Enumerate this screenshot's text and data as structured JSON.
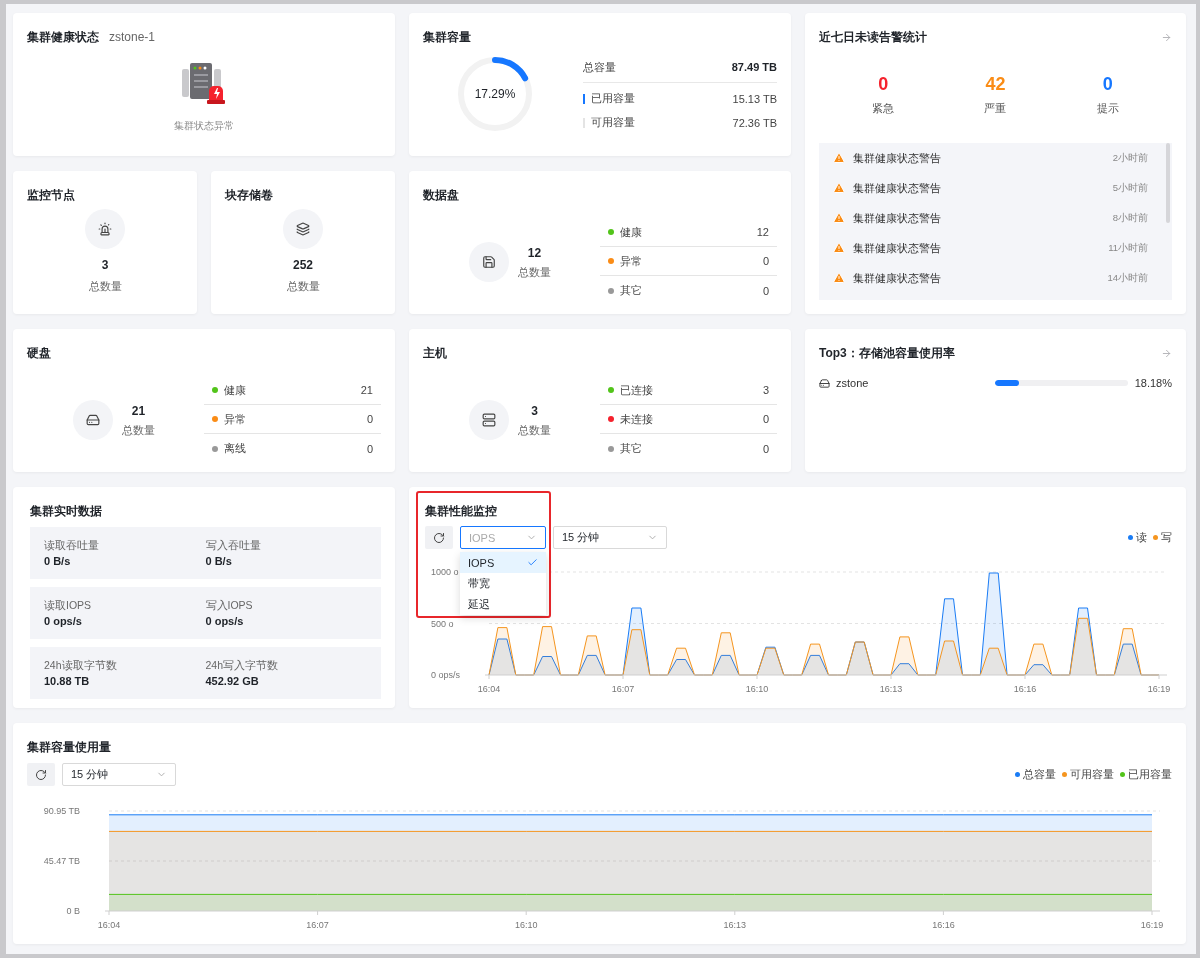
{
  "health": {
    "title": "集群健康状态",
    "cluster": "zstone-1",
    "status": "集群状态异常",
    "abnormal": true
  },
  "capacity": {
    "title": "集群容量",
    "percent": "17.29%",
    "rows": [
      {
        "kind": "total",
        "label": "总容量",
        "value": "87.49 TB"
      },
      {
        "kind": "used",
        "label": "已用容量",
        "value": "15.13 TB"
      },
      {
        "kind": "free",
        "label": "可用容量",
        "value": "72.36 TB"
      }
    ]
  },
  "alerts": {
    "title": "近七日未读告警统计",
    "counts": [
      {
        "value": "0",
        "label": "紧急",
        "color": "#f5222d"
      },
      {
        "value": "42",
        "label": "严重",
        "color": "#fa8c16"
      },
      {
        "value": "0",
        "label": "提示",
        "color": "#1677ff"
      }
    ],
    "items": [
      {
        "text": "集群健康状态警告",
        "time": "2小时前"
      },
      {
        "text": "集群健康状态警告",
        "time": "5小时前"
      },
      {
        "text": "集群健康状态警告",
        "time": "8小时前"
      },
      {
        "text": "集群健康状态警告",
        "time": "11小时前"
      },
      {
        "text": "集群健康状态警告",
        "time": "14小时前"
      }
    ]
  },
  "monitor_nodes": {
    "title": "监控节点",
    "count": "3",
    "label": "总数量"
  },
  "block_volumes": {
    "title": "块存储卷",
    "count": "252",
    "label": "总数量"
  },
  "data_disks": {
    "title": "数据盘",
    "count": "12",
    "label": "总数量",
    "statuses": [
      {
        "label": "健康",
        "value": "12",
        "color": "#52c41a"
      },
      {
        "label": "异常",
        "value": "0",
        "color": "#fa8c16"
      },
      {
        "label": "其它",
        "value": "0",
        "color": "#999999"
      }
    ]
  },
  "disks": {
    "title": "硬盘",
    "count": "21",
    "label": "总数量",
    "statuses": [
      {
        "label": "健康",
        "value": "21",
        "color": "#52c41a"
      },
      {
        "label": "异常",
        "value": "0",
        "color": "#fa8c16"
      },
      {
        "label": "离线",
        "value": "0",
        "color": "#999999"
      }
    ]
  },
  "hosts": {
    "title": "主机",
    "count": "3",
    "label": "总数量",
    "statuses": [
      {
        "label": "已连接",
        "value": "3",
        "color": "#52c41a"
      },
      {
        "label": "未连接",
        "value": "0",
        "color": "#f5222d"
      },
      {
        "label": "其它",
        "value": "0",
        "color": "#999999"
      }
    ]
  },
  "top3": {
    "title": "Top3：存储池容量使用率",
    "pools": [
      {
        "name": "zstone",
        "level": 0.1818,
        "percent": "18.18%"
      }
    ]
  },
  "realtime": {
    "title": "集群实时数据",
    "groups": [
      {
        "items": [
          {
            "label": "读取吞吐量",
            "value": "0 B/s"
          },
          {
            "label": "写入吞吐量",
            "value": "0 B/s"
          }
        ]
      },
      {
        "items": [
          {
            "label": "读取IOPS",
            "value": "0 ops/s"
          },
          {
            "label": "写入IOPS",
            "value": "0 ops/s"
          }
        ]
      },
      {
        "items": [
          {
            "label": "24h读取字节数",
            "value": "10.88 TB"
          },
          {
            "label": "24h写入字节数",
            "value": "452.92 GB"
          }
        ]
      }
    ]
  },
  "performance": {
    "title": "集群性能监控",
    "highlighted": true,
    "metric_select": {
      "value": "IOPS",
      "open": true,
      "options": [
        {
          "label": "IOPS",
          "selected": true
        },
        {
          "label": "带宽",
          "selected": false
        },
        {
          "label": "延迟",
          "selected": false
        }
      ]
    },
    "range_select": {
      "value": "15 分钟"
    },
    "chart_data": {
      "type": "area",
      "ylim": [
        0,
        1000
      ],
      "yticks": [
        {
          "value": 0,
          "label": "0 ops/s"
        },
        {
          "value": 500,
          "label": "500 o"
        },
        {
          "value": 1000,
          "label": "1000 o"
        }
      ],
      "categories": [
        "16:04",
        null,
        null,
        null,
        null,
        null,
        null,
        null,
        null,
        null,
        null,
        null,
        null,
        null,
        null,
        "16:07",
        null,
        null,
        null,
        null,
        null,
        null,
        null,
        null,
        null,
        null,
        null,
        null,
        null,
        null,
        "16:10",
        null,
        null,
        null,
        null,
        null,
        null,
        null,
        null,
        null,
        null,
        null,
        null,
        null,
        null,
        "16:13",
        null,
        null,
        null,
        null,
        null,
        null,
        null,
        null,
        null,
        null,
        null,
        null,
        null,
        null,
        "16:16",
        null,
        null,
        null,
        null,
        null,
        null,
        null,
        null,
        null,
        null,
        null,
        null,
        null,
        null,
        "16:19"
      ],
      "series": [
        {
          "name": "读",
          "color": "#1a7cf5",
          "values": [
            0,
            350,
            350,
            0,
            0,
            0,
            180,
            180,
            0,
            0,
            0,
            190,
            190,
            0,
            0,
            0,
            650,
            650,
            0,
            0,
            0,
            150,
            150,
            0,
            0,
            0,
            190,
            190,
            0,
            0,
            0,
            270,
            270,
            0,
            0,
            0,
            190,
            190,
            0,
            0,
            0,
            320,
            320,
            0,
            0,
            0,
            110,
            110,
            0,
            0,
            0,
            740,
            740,
            0,
            0,
            0,
            990,
            990,
            0,
            0,
            0,
            100,
            100,
            0,
            0,
            0,
            650,
            650,
            0,
            0,
            0,
            300,
            300,
            0,
            0,
            0
          ]
        },
        {
          "name": "写",
          "color": "#f5951f",
          "values": [
            0,
            460,
            460,
            0,
            0,
            0,
            470,
            470,
            0,
            0,
            0,
            380,
            380,
            0,
            0,
            0,
            440,
            440,
            0,
            0,
            0,
            260,
            260,
            0,
            0,
            0,
            410,
            410,
            0,
            0,
            0,
            260,
            260,
            0,
            0,
            0,
            300,
            300,
            0,
            0,
            0,
            320,
            320,
            0,
            0,
            0,
            370,
            370,
            0,
            0,
            0,
            330,
            330,
            0,
            0,
            0,
            260,
            260,
            0,
            0,
            0,
            300,
            300,
            0,
            0,
            0,
            550,
            550,
            0,
            0,
            0,
            450,
            450,
            0,
            0,
            0
          ]
        }
      ]
    }
  },
  "capacity_usage": {
    "title": "集群容量使用量",
    "range_select": {
      "value": "15 分钟"
    },
    "chart_data": {
      "type": "area",
      "ylim": [
        0,
        90.95
      ],
      "yticks": [
        {
          "value": 0,
          "label": "0 B"
        },
        {
          "value": 45.47,
          "label": "45.47 TB"
        },
        {
          "value": 90.95,
          "label": "90.95 TB"
        }
      ],
      "categories": [
        "16:04",
        "16:07",
        "16:10",
        "16:13",
        "16:16",
        "16:19"
      ],
      "series": [
        {
          "name": "总容量",
          "color": "#1a7cf5",
          "values": [
            87.49,
            87.49,
            87.49,
            87.49,
            87.49,
            87.49
          ]
        },
        {
          "name": "可用容量",
          "color": "#f5951f",
          "values": [
            72.36,
            72.36,
            72.36,
            72.36,
            72.36,
            72.36
          ]
        },
        {
          "name": "已用容量",
          "color": "#52c41a",
          "values": [
            15.13,
            15.13,
            15.13,
            15.13,
            15.13,
            15.13
          ]
        }
      ]
    }
  }
}
